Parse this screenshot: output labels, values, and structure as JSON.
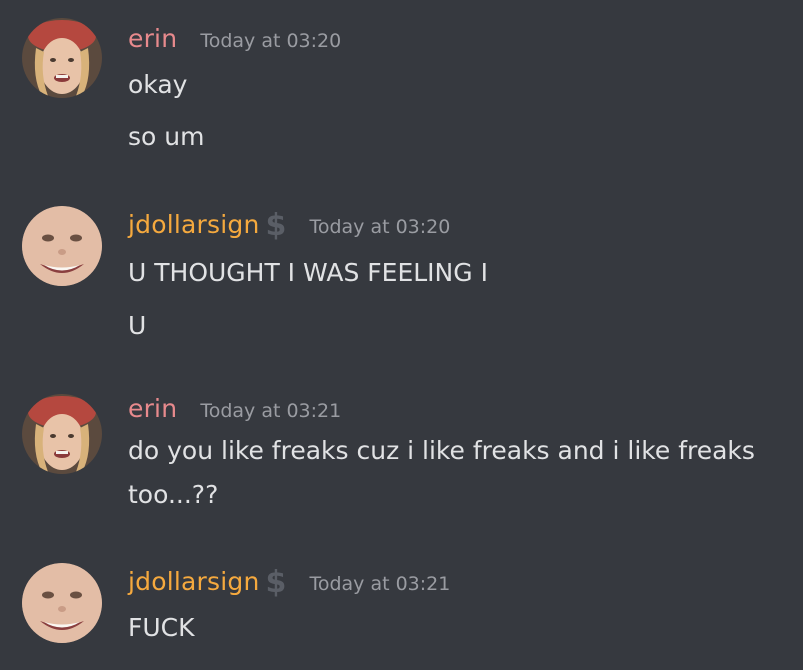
{
  "messages": [
    {
      "author": "erin",
      "timestamp": "Today at 03:20",
      "lines": [
        "okay",
        "so um"
      ]
    },
    {
      "author": "jdollarsign",
      "badge_icon": "dollar-sign-icon",
      "badge": "$",
      "timestamp": "Today at 03:20",
      "lines": [
        "U THOUGHT I WAS FEELING I",
        "U"
      ]
    },
    {
      "author": "erin",
      "timestamp": "Today at 03:21",
      "lines": [
        "do you like freaks cuz i like freaks and i like freaks",
        "too...??"
      ]
    },
    {
      "author": "jdollarsign",
      "badge_icon": "dollar-sign-icon",
      "badge": "$",
      "timestamp": "Today at 03:21",
      "lines": [
        "FUCK"
      ]
    }
  ],
  "colors": {
    "background": "#36393f",
    "erin": "#e88a8d",
    "jdollarsign": "#f5a93e",
    "timestamp": "#9a9ca2",
    "text": "#e1e2e4"
  }
}
